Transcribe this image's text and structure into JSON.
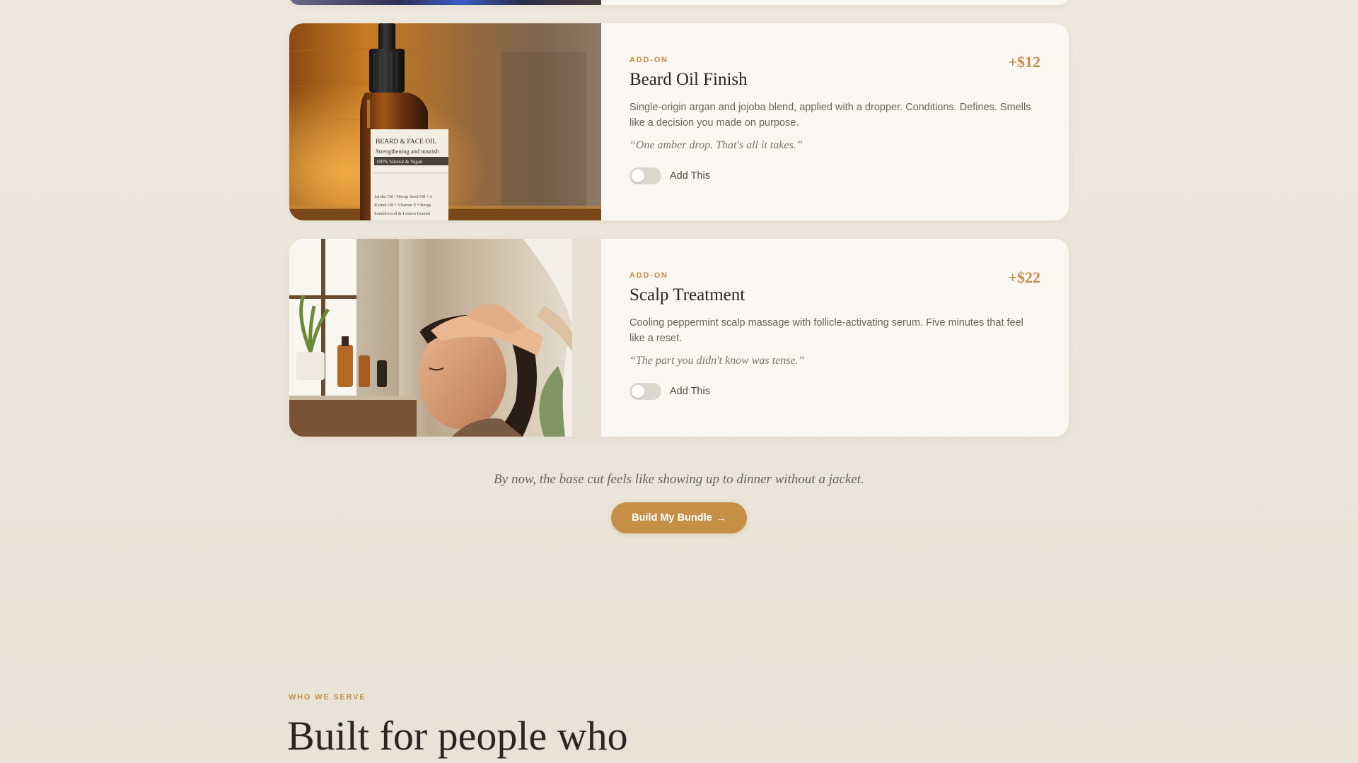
{
  "cards": [
    {
      "eyebrow": "ADD-ON",
      "title": "Beard Oil Finish",
      "price": "+$12",
      "description": "Single-origin argan and jojoba blend, applied with a dropper. Conditions. Defines. Smells like a decision you made on purpose.",
      "quote": "“One amber drop. That's all it takes.”",
      "toggle_label": "Add This",
      "toggle_on": false,
      "bottle_label": {
        "line1": "BEARD & FACE OIL",
        "line2": "Strengthening and nourish",
        "badge": "100% Natural & Vegan",
        "ing1": "Jojoba Oil • Hemp Seed Oil • A",
        "ing2": "Kernel Oil • Vitamin E • Berga",
        "ing3": "Sandalwood & Lemon Essenti"
      }
    },
    {
      "eyebrow": "ADD-ON",
      "title": "Scalp Treatment",
      "price": "+$22",
      "description": "Cooling peppermint scalp massage with follicle-activating serum. Five minutes that feel like a reset.",
      "quote": "“The part you didn't know was tense.”",
      "toggle_label": "Add This",
      "toggle_on": false
    }
  ],
  "cta": {
    "tagline": "By now, the base cut feels like showing up to dinner without a jacket.",
    "button_label": "Build My Bundle",
    "button_arrow": "→"
  },
  "section": {
    "eyebrow": "WHO WE SERVE",
    "heading": "Built for people who"
  },
  "colors": {
    "accent": "#c58f45",
    "background": "#ede6da",
    "card": "#faf7f2",
    "text_dark": "#2a2521"
  }
}
